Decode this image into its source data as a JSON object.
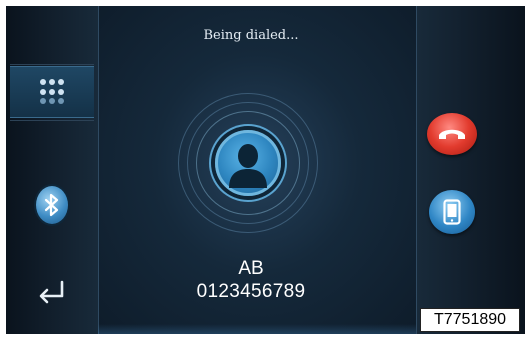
{
  "call": {
    "status": "Being dialed...",
    "contact_name": "AB",
    "contact_number": "0123456789"
  },
  "left_menu": {
    "icons": [
      "keypad-icon",
      "bluetooth-icon",
      "back-arrow-icon"
    ]
  },
  "right_menu": {
    "icons": [
      "hang-up-icon",
      "handset-icon"
    ]
  },
  "figure_code": "T7751890",
  "colors": {
    "background": "#0e1a26",
    "hangup": "#e23b2e",
    "accent_blue": "#2f86c5"
  }
}
